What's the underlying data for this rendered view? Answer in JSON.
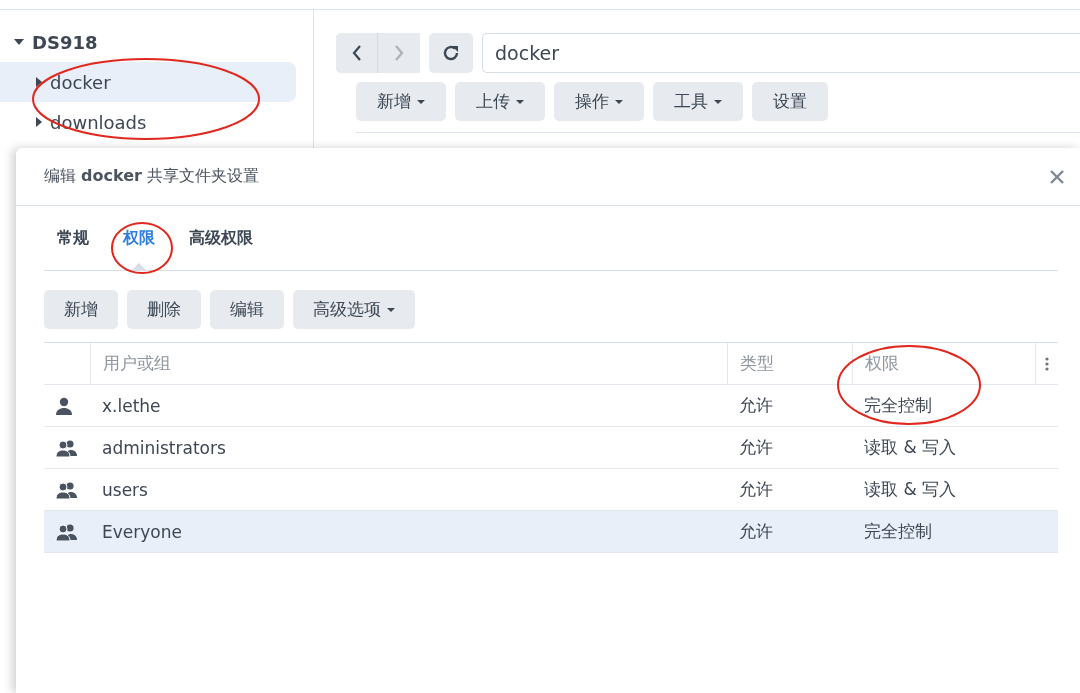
{
  "sidebar": {
    "tree": [
      {
        "label": "DS918",
        "expanded": true,
        "children": [
          {
            "label": "docker",
            "expanded": false,
            "selected": true
          },
          {
            "label": "downloads",
            "expanded": false,
            "selected": false
          }
        ]
      }
    ]
  },
  "file_station": {
    "address": "docker",
    "toolbar": [
      {
        "label": "新增",
        "dropdown": true
      },
      {
        "label": "上传",
        "dropdown": true
      },
      {
        "label": "操作",
        "dropdown": true
      },
      {
        "label": "工具",
        "dropdown": true
      },
      {
        "label": "设置",
        "dropdown": false
      }
    ]
  },
  "dialog": {
    "title": "编辑 **docker** 共享文件夹设置",
    "tabs": [
      {
        "label": "常规",
        "selected": false
      },
      {
        "label": "权限",
        "selected": true
      },
      {
        "label": "高级权限",
        "selected": false
      }
    ],
    "buttons": [
      {
        "label": "新增",
        "dropdown": false
      },
      {
        "label": "删除",
        "dropdown": false
      },
      {
        "label": "编辑",
        "dropdown": false
      },
      {
        "label": "高级选项",
        "dropdown": true
      }
    ],
    "table": {
      "columns": [
        "用户或组",
        "类型",
        "权限"
      ],
      "rows": [
        {
          "kind": "user",
          "name": "x.lethe",
          "type": "允许",
          "permission": "完全控制",
          "selected": false
        },
        {
          "kind": "group",
          "name": "administrators",
          "type": "允许",
          "permission": "读取 & 写入",
          "selected": false
        },
        {
          "kind": "group",
          "name": "users",
          "type": "允许",
          "permission": "读取 & 写入",
          "selected": false
        },
        {
          "kind": "group",
          "name": "Everyone",
          "type": "允许",
          "permission": "完全控制",
          "selected": true
        }
      ]
    }
  }
}
